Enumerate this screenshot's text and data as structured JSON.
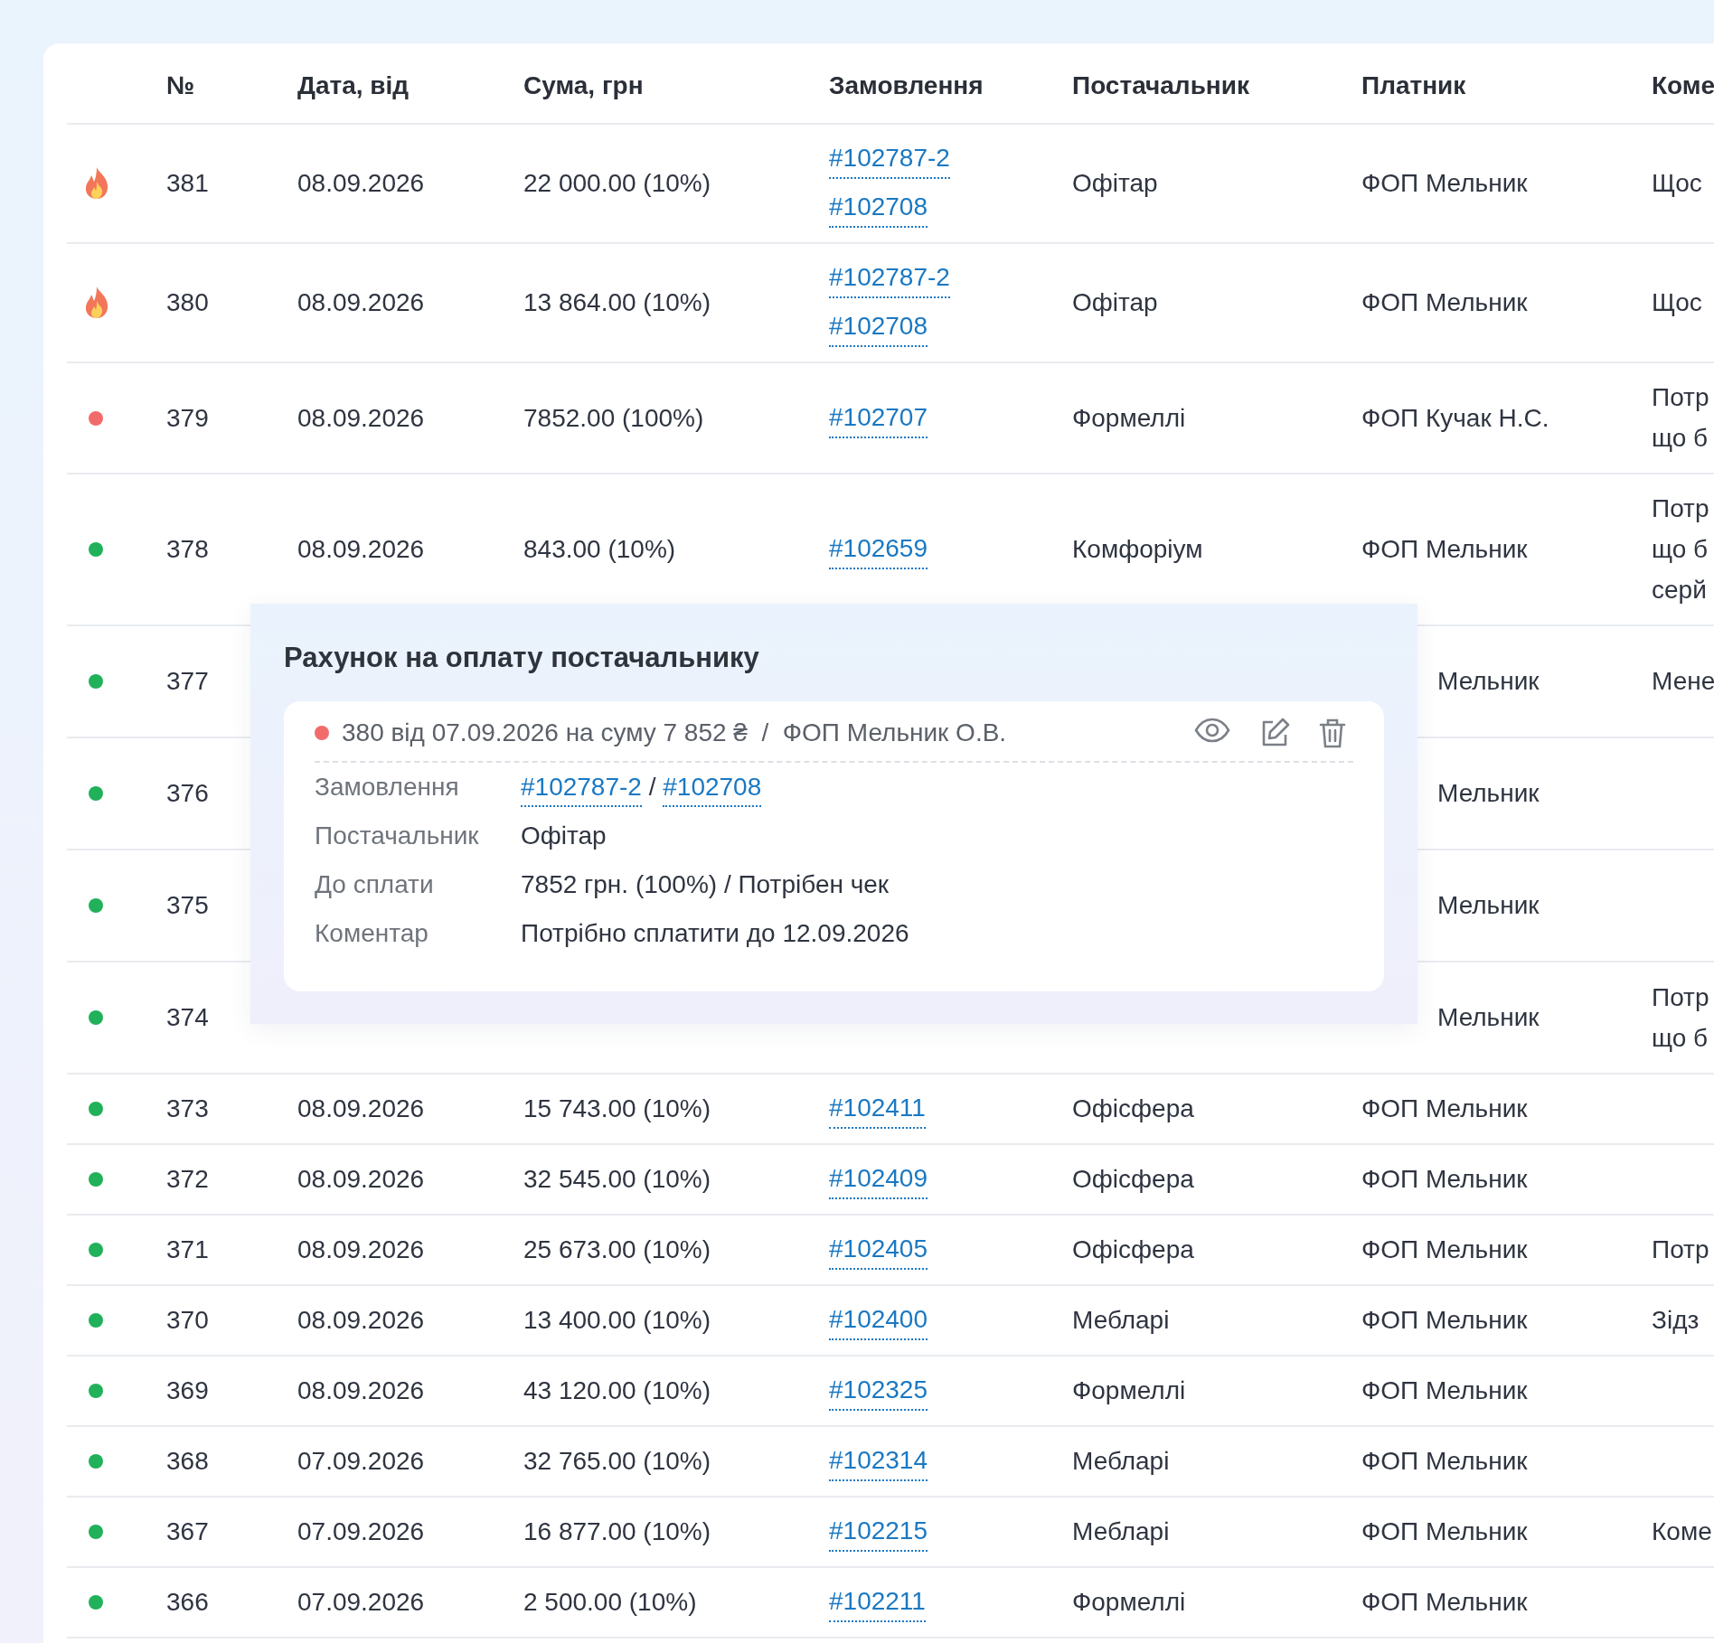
{
  "table": {
    "columns": [
      "№",
      "Дата, від",
      "Сума, грн",
      "Замовлення",
      "Постачальник",
      "Платник",
      "Коме"
    ],
    "rows": [
      {
        "kind": "fire",
        "number": "381",
        "date": "08.09.2026",
        "amount": "22 000.00 (10%)",
        "orders": [
          "#102787-2",
          "#102708"
        ],
        "supplier": "Офітар",
        "payer": "ФОП Мельник",
        "comment": [
          "Щос"
        ]
      },
      {
        "kind": "fire",
        "number": "380",
        "date": "08.09.2026",
        "amount": "13 864.00 (10%)",
        "orders": [
          "#102787-2",
          "#102708"
        ],
        "supplier": "Офітар",
        "payer": "ФОП Мельник",
        "comment": [
          "Щос"
        ]
      },
      {
        "kind": "dot",
        "color": "#f26b6b",
        "number": "379",
        "date": "08.09.2026",
        "amount": "7852.00 (100%)",
        "orders": [
          "#102707"
        ],
        "supplier": "Формеллі",
        "payer": "ФОП Кучак Н.С.",
        "comment": [
          "Потр",
          "що б"
        ]
      },
      {
        "kind": "dot",
        "color": "#20b15a",
        "number": "378",
        "date": "08.09.2026",
        "amount": "843.00 (10%)",
        "orders": [
          "#102659"
        ],
        "supplier": "Комфоріум",
        "payer": "ФОП Мельник",
        "comment": [
          "Потр",
          "що б",
          "серй"
        ]
      },
      {
        "kind": "dot",
        "color": "#20b15a",
        "number": "377",
        "payer": "Мельник",
        "comment": [
          "Мене"
        ]
      },
      {
        "kind": "dot",
        "color": "#20b15a",
        "number": "376",
        "payer": "Мельник"
      },
      {
        "kind": "dot",
        "color": "#20b15a",
        "number": "375",
        "payer": "Мельник"
      },
      {
        "kind": "dot",
        "color": "#20b15a",
        "number": "374",
        "payer": "Мельник",
        "comment": [
          "Потр",
          "що б"
        ]
      },
      {
        "kind": "dot",
        "color": "#20b15a",
        "number": "373",
        "date": "08.09.2026",
        "amount": "15 743.00 (10%)",
        "orders": [
          "#102411"
        ],
        "supplier": "Офісфера",
        "payer": "ФОП Мельник"
      },
      {
        "kind": "dot",
        "color": "#20b15a",
        "number": "372",
        "date": "08.09.2026",
        "amount": "32 545.00 (10%)",
        "orders": [
          "#102409"
        ],
        "supplier": "Офісфера",
        "payer": "ФОП Мельник"
      },
      {
        "kind": "dot",
        "color": "#20b15a",
        "number": "371",
        "date": "08.09.2026",
        "amount": "25 673.00 (10%)",
        "orders": [
          "#102405"
        ],
        "supplier": "Офісфера",
        "payer": "ФОП Мельник",
        "comment": [
          "Потр"
        ]
      },
      {
        "kind": "dot",
        "color": "#20b15a",
        "number": "370",
        "date": "08.09.2026",
        "amount": "13 400.00 (10%)",
        "orders": [
          "#102400"
        ],
        "supplier": "Мебларі",
        "payer": "ФОП Мельник",
        "comment": [
          "Зідз"
        ]
      },
      {
        "kind": "dot",
        "color": "#20b15a",
        "number": "369",
        "date": "08.09.2026",
        "amount": "43 120.00 (10%)",
        "orders": [
          "#102325"
        ],
        "supplier": "Формеллі",
        "payer": "ФОП Мельник"
      },
      {
        "kind": "dot",
        "color": "#20b15a",
        "number": "368",
        "date": "07.09.2026",
        "amount": "32 765.00 (10%)",
        "orders": [
          "#102314"
        ],
        "supplier": "Мебларі",
        "payer": "ФОП Мельник"
      },
      {
        "kind": "dot",
        "color": "#20b15a",
        "number": "367",
        "date": "07.09.2026",
        "amount": "16 877.00 (10%)",
        "orders": [
          "#102215"
        ],
        "supplier": "Мебларі",
        "payer": "ФОП Мельник",
        "comment": [
          "Коме"
        ]
      },
      {
        "kind": "dot",
        "color": "#20b15a",
        "number": "366",
        "date": "07.09.2026",
        "amount": "2 500.00 (10%)",
        "orders": [
          "#102211"
        ],
        "supplier": "Формеллі",
        "payer": "ФОП Мельник"
      }
    ]
  },
  "popup": {
    "title": "Рахунок на оплату постачальнику",
    "invoice": {
      "kind": "dot",
      "color": "#f26b6b",
      "summary": "380 від 07.09.2026 на суму 7 852 ₴  /  ФОП Мельник О.В.",
      "details": [
        {
          "kind": "links",
          "label": "Замовлення",
          "links": [
            "#102787-2",
            "#102708"
          ],
          "separator": "/"
        },
        {
          "kind": "text",
          "label": "Постачальник",
          "value": "Офітар"
        },
        {
          "kind": "text",
          "label": "До сплати",
          "value": "7852 грн. (100%) / Потрібен чек"
        },
        {
          "kind": "text",
          "label": "Коментар",
          "value": "Потрібно сплатити до 12.09.2026"
        }
      ]
    }
  }
}
